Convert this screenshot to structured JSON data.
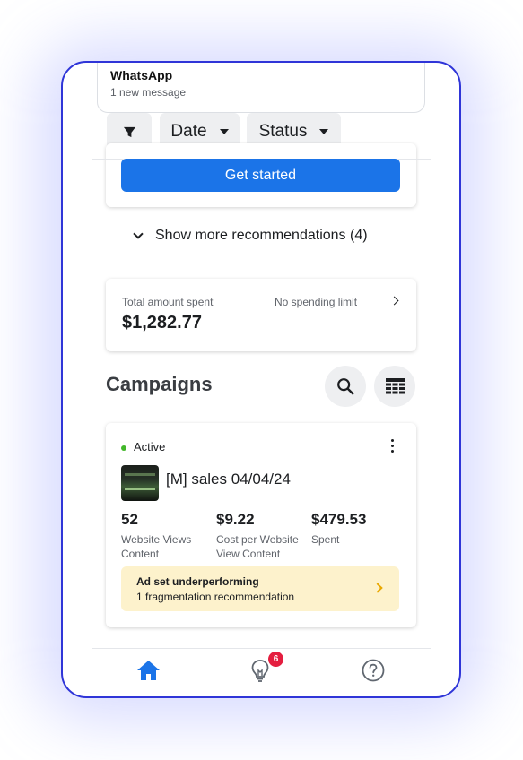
{
  "notification": {
    "app": "WhatsApp",
    "message": "1 new message"
  },
  "filters": {
    "filter_icon": "filter-icon",
    "date_label": "Date",
    "status_label": "Status"
  },
  "recommendations": {
    "cta_label": "Get started",
    "show_more_label": "Show more recommendations (4)"
  },
  "spend": {
    "label": "Total amount spent",
    "value": "$1,282.77",
    "limit_label": "No spending limit"
  },
  "campaigns": {
    "title": "Campaigns",
    "search_icon": "search-icon",
    "table_icon": "table-icon",
    "items": [
      {
        "status": "Active",
        "status_color": "#42b72a",
        "name": "[M] sales 04/04/24",
        "metrics": [
          {
            "value": "52",
            "label": "Website Views Content"
          },
          {
            "value": "$9.22",
            "label": "Cost per Website View Content"
          },
          {
            "value": "$479.53",
            "label": "Spent"
          }
        ],
        "alert": {
          "title": "Ad set underperforming",
          "subtitle": "1 fragmentation recommendation"
        }
      }
    ]
  },
  "bottom_nav": {
    "items": [
      {
        "icon": "home-icon",
        "active": true
      },
      {
        "icon": "lightbulb-icon",
        "badge": "6"
      },
      {
        "icon": "help-icon"
      }
    ]
  },
  "colors": {
    "accent": "#1b74e8",
    "frame_border": "#2f35d8",
    "badge": "#e41e3f",
    "warning_bg": "#fdf2cc"
  }
}
